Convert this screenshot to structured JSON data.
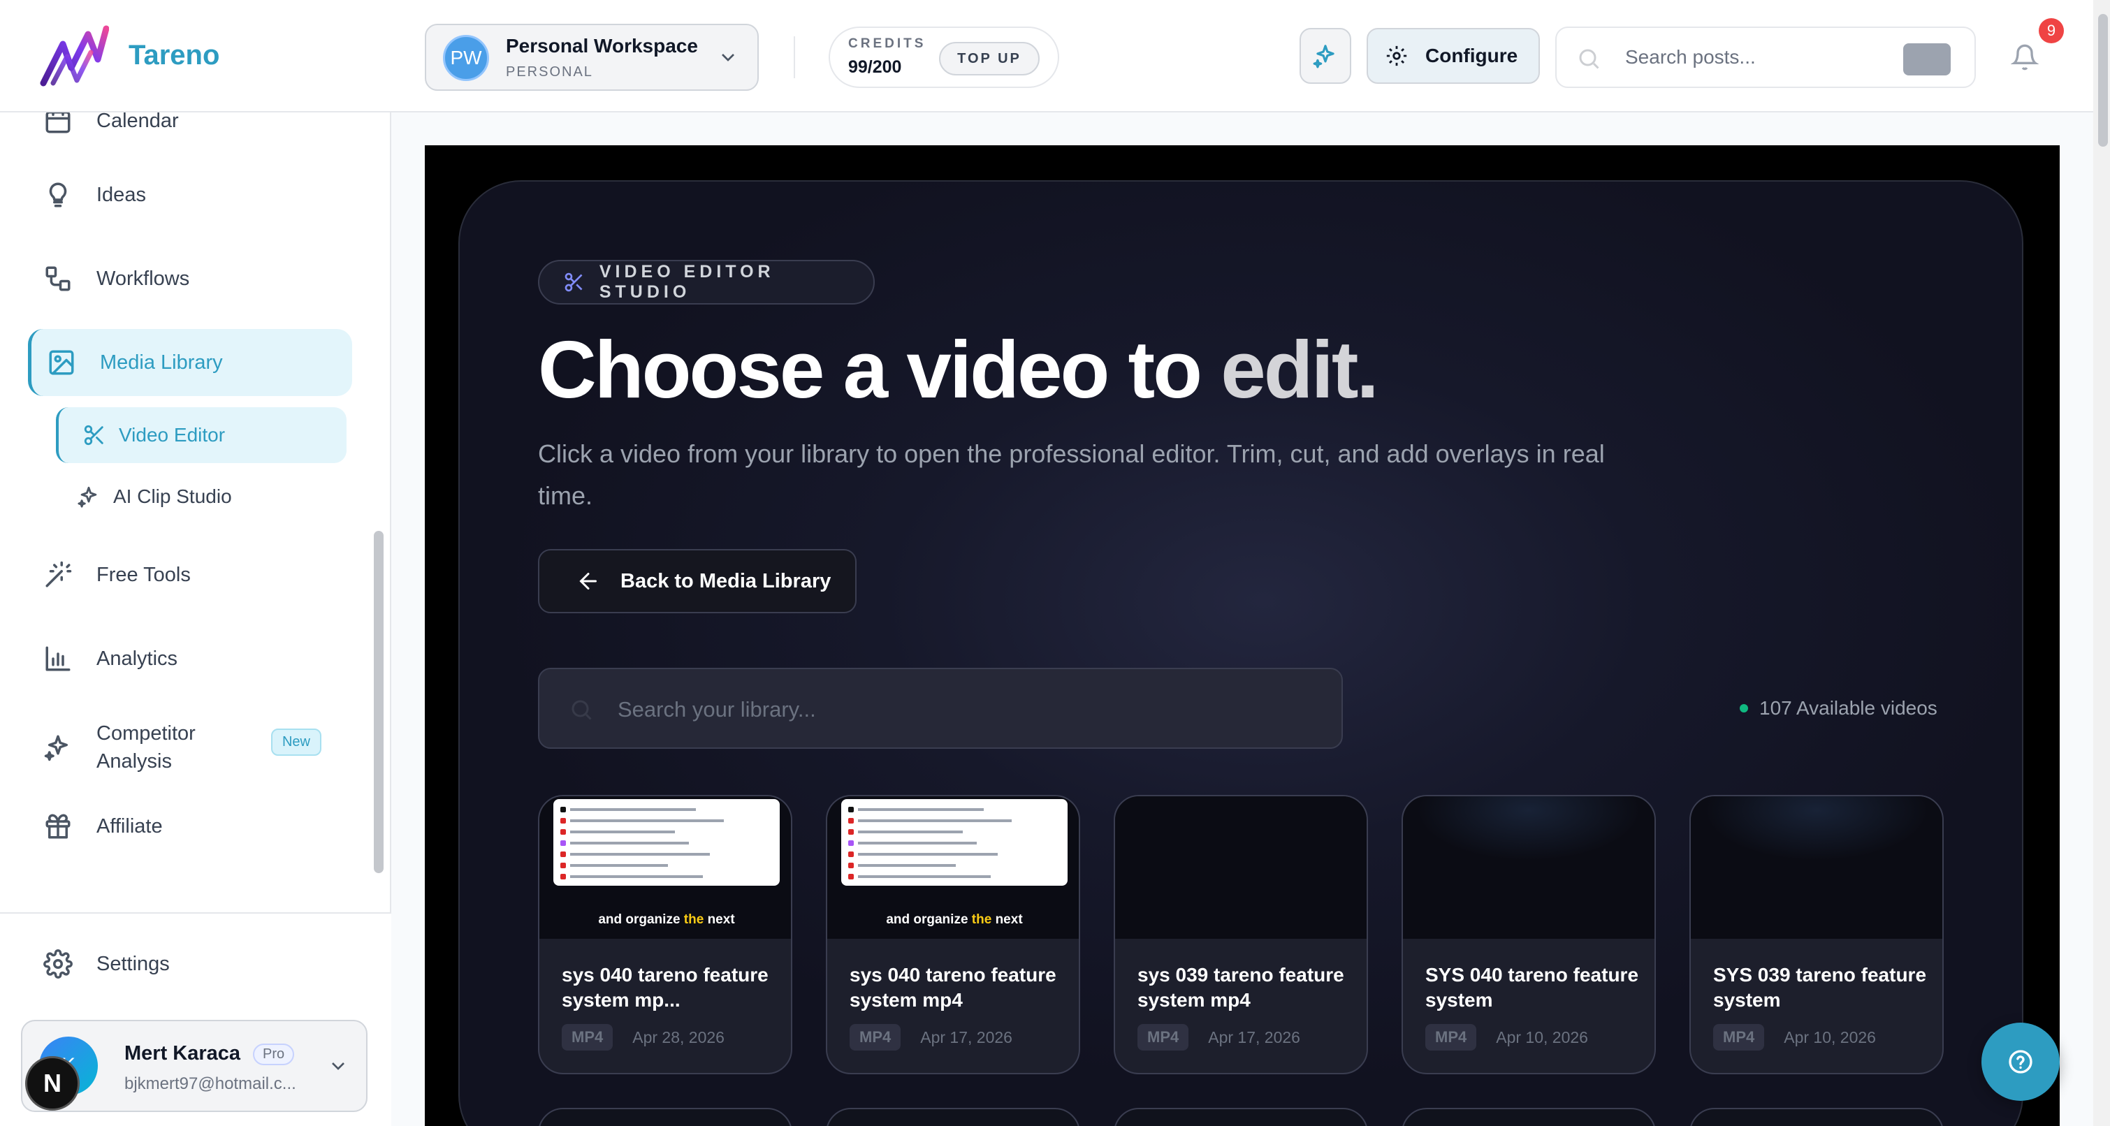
{
  "brand": {
    "name": "Tareno"
  },
  "sidebar": {
    "items": [
      {
        "label": "Calendar",
        "icon": "calendar-icon"
      },
      {
        "label": "Ideas",
        "icon": "lightbulb-icon"
      },
      {
        "label": "Workflows",
        "icon": "workflow-icon"
      },
      {
        "label": "Media Library",
        "icon": "image-icon",
        "active": true
      },
      {
        "label": "Video Editor",
        "icon": "scissors-icon",
        "active": true
      },
      {
        "label": "AI Clip Studio",
        "icon": "sparkles-icon"
      },
      {
        "label": "Free Tools",
        "icon": "magic-wand-icon"
      },
      {
        "label": "Analytics",
        "icon": "bar-chart-icon"
      },
      {
        "label": "Competitor Analysis",
        "icon": "sparkles-icon",
        "badge": "New"
      },
      {
        "label": "Affiliate",
        "icon": "gift-icon"
      },
      {
        "label": "Settings",
        "icon": "gear-icon"
      }
    ],
    "user": {
      "initials": "K",
      "name": "Mert Karaca",
      "plan": "Pro",
      "email": "bjkmert97@hotmail.c..."
    },
    "corner_badge": "N"
  },
  "topbar": {
    "workspace": {
      "initials": "PW",
      "name": "Personal Workspace",
      "type": "PERSONAL"
    },
    "credits": {
      "label": "CREDITS",
      "value": "99/200",
      "topup": "TOP UP"
    },
    "configure": "Configure",
    "search_placeholder": "Search posts...",
    "notifications": "9"
  },
  "studio": {
    "tag": "VIDEO EDITOR STUDIO",
    "title_main": "Choose a video to ",
    "title_dim": "edit.",
    "subtitle": "Click a video from your library to open the professional editor. Trim, cut, and add overlays in real time.",
    "back_label": "Back to Media Library",
    "search_placeholder": "Search your library...",
    "available": "107 Available videos",
    "videos": [
      {
        "title": "sys 040 tareno feature system mp...",
        "format": "MP4",
        "date": "Apr 28, 2026",
        "caption_a": "and organize ",
        "caption_b": "the",
        "caption_c": " next"
      },
      {
        "title": "sys 040 tareno feature system mp4",
        "format": "MP4",
        "date": "Apr 17, 2026",
        "caption_a": "and organize ",
        "caption_b": "the",
        "caption_c": " next"
      },
      {
        "title": "sys 039 tareno feature system mp4",
        "format": "MP4",
        "date": "Apr 17, 2026"
      },
      {
        "title": "SYS 040 tareno feature system",
        "format": "MP4",
        "date": "Apr 10, 2026"
      },
      {
        "title": "SYS 039 tareno feature system",
        "format": "MP4",
        "date": "Apr 10, 2026"
      }
    ]
  },
  "colors": {
    "accent": "#2d9cc1",
    "studio_bg": "#16182a",
    "badge_red": "#ef4444"
  }
}
